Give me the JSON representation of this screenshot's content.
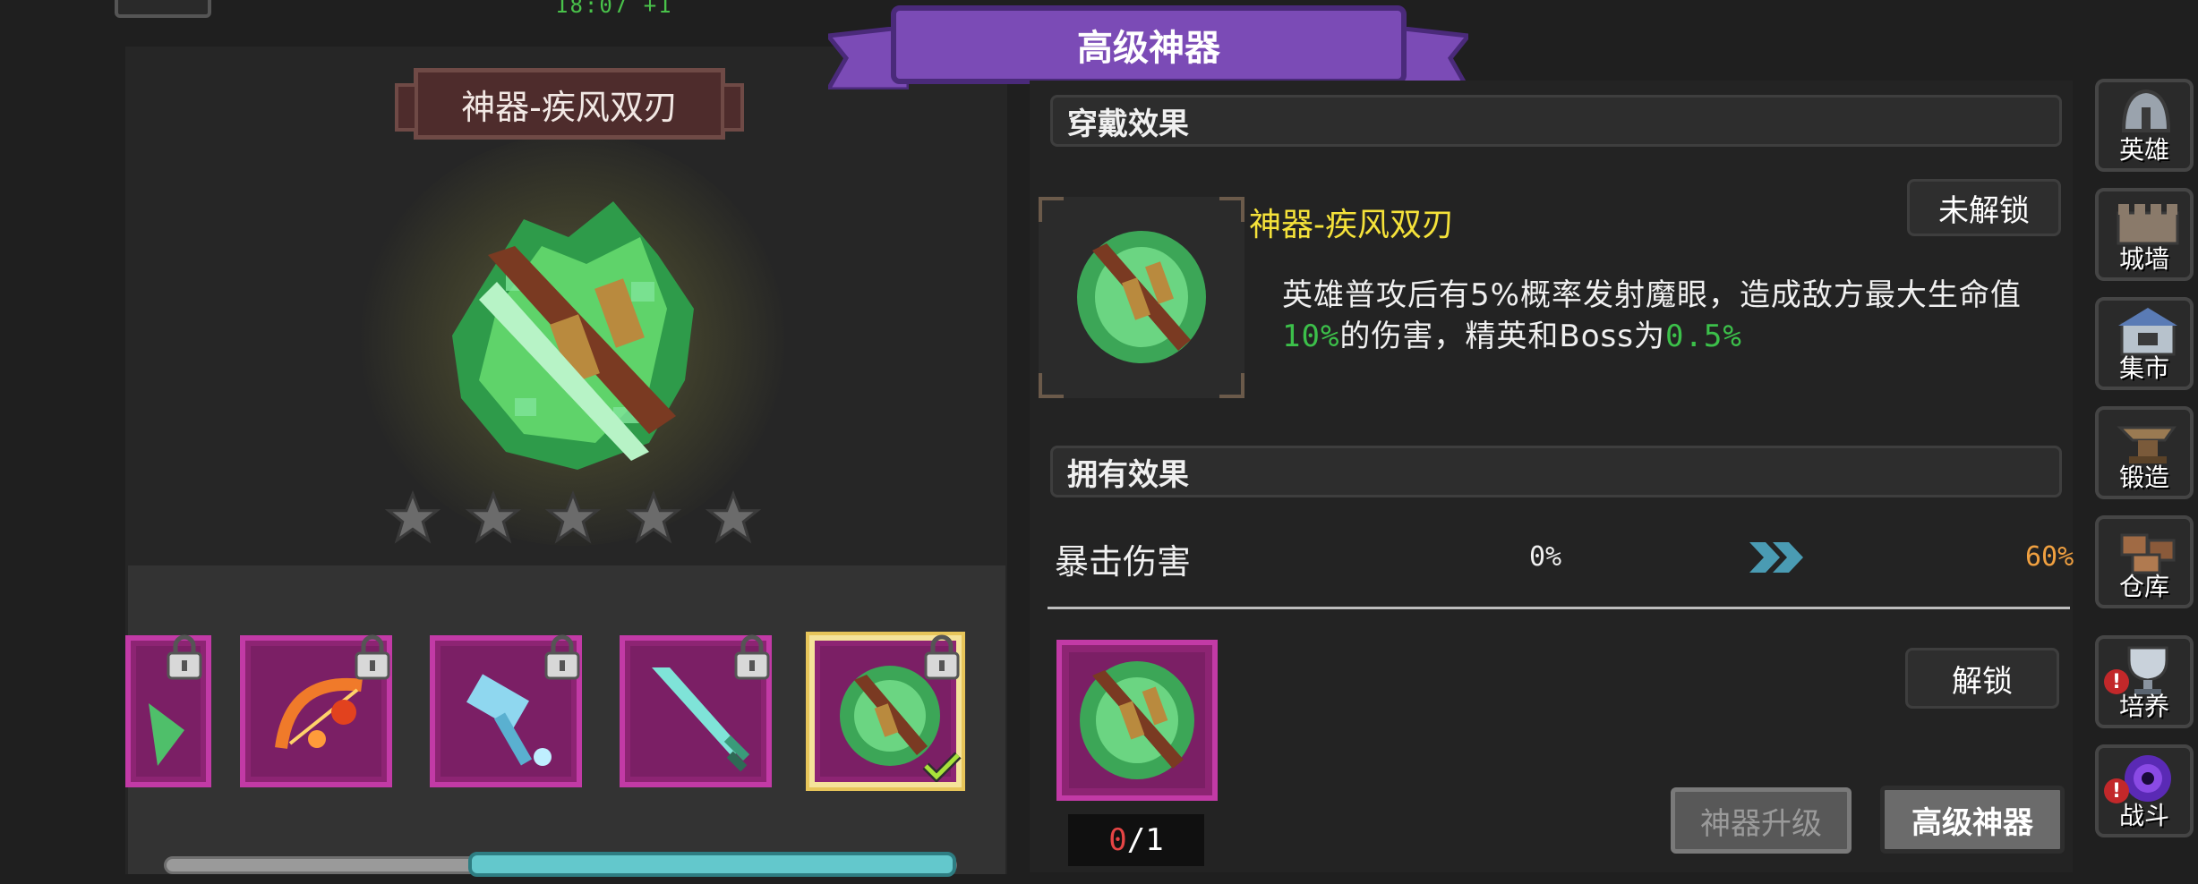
{
  "status_bar": {
    "time": "18:07 +1"
  },
  "title_ribbon": {
    "title": "高级神器"
  },
  "artifact_display": {
    "name": "神器-疾风双刃",
    "star_count": 5,
    "stars_filled": 0,
    "weapon_icon": "twin-blades-green-flame-icon"
  },
  "gallery": {
    "items": [
      {
        "icon": "partial-green-item-icon",
        "locked": true
      },
      {
        "icon": "fire-bow-icon",
        "locked": true
      },
      {
        "icon": "ice-hammer-icon",
        "locked": true
      },
      {
        "icon": "crystal-sword-icon",
        "locked": true
      },
      {
        "icon": "twin-blades-green-flame-icon",
        "locked": true,
        "selected": true,
        "equipped": true
      }
    ],
    "scroll_position": 0.62
  },
  "wear_effect": {
    "header": "穿戴效果",
    "name": "神器-疾风双刃",
    "status_badge": "未解锁",
    "description_line1": "英雄普攻后有5%概率发射魔眼，造成敌方最大生命值",
    "description_line2_value1": "10%",
    "description_line2_mid": "的伤害，精英和Boss为",
    "description_line2_value2": "0.5%"
  },
  "owned_effect": {
    "header": "拥有效果",
    "stat_label": "暴击伤害",
    "stat_from": "0%",
    "stat_to": "60%"
  },
  "owned_item": {
    "count_current": "0",
    "count_sep": "/",
    "count_required": "1",
    "unlock_button": "解锁"
  },
  "bottom_buttons": {
    "upgrade": "神器升级",
    "advanced": "高级神器"
  },
  "sidebar": {
    "items": [
      {
        "label": "英雄",
        "icon": "helmet-icon",
        "alert": false
      },
      {
        "label": "城墙",
        "icon": "wall-icon",
        "alert": false
      },
      {
        "label": "集市",
        "icon": "market-icon",
        "alert": false
      },
      {
        "label": "锻造",
        "icon": "anvil-icon",
        "alert": false
      },
      {
        "label": "仓库",
        "icon": "warehouse-icon",
        "alert": false
      },
      {
        "label": "培养",
        "icon": "trophy-icon",
        "alert": true,
        "alert_mark": "!"
      },
      {
        "label": "战斗",
        "icon": "portal-icon",
        "alert": true,
        "alert_mark": "!"
      }
    ]
  },
  "colors": {
    "effect_name": "#f5e23a",
    "value_green": "#3cc04a",
    "stat_to": "#f0a040",
    "ribbon": "#7b4bb6",
    "slot_bg": "#8d2473"
  }
}
